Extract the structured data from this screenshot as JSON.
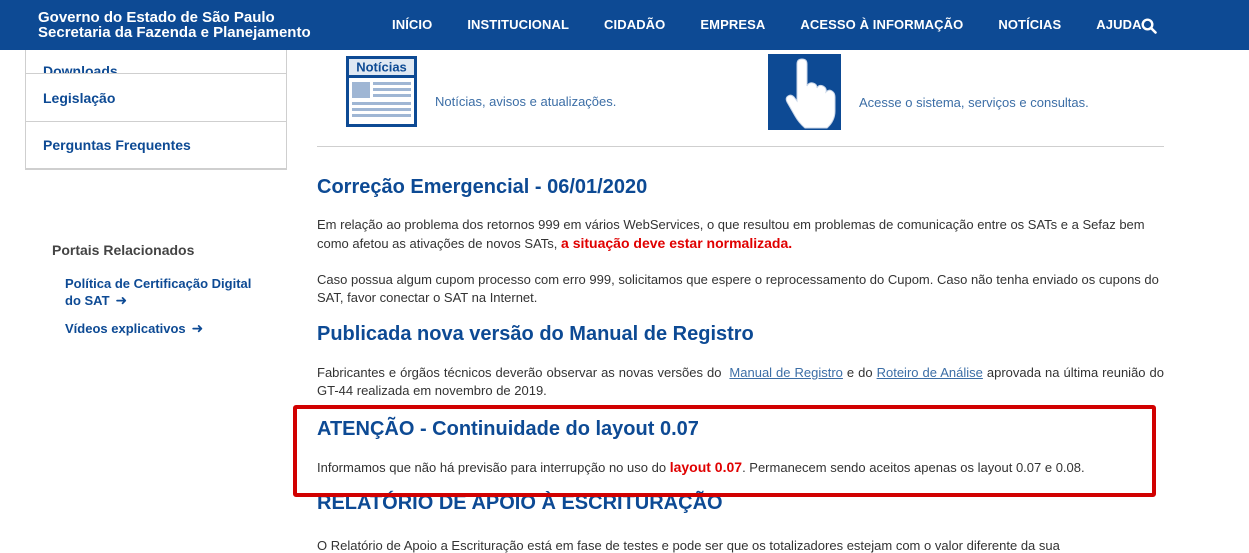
{
  "header": {
    "brand_line1": "Governo do Estado de São Paulo",
    "brand_line2": "Secretaria da Fazenda e Planejamento",
    "nav": [
      "INÍCIO",
      "INSTITUCIONAL",
      "CIDADÃO",
      "EMPRESA",
      "ACESSO À INFORMAÇÃO",
      "NOTÍCIAS",
      "AJUDA"
    ],
    "search_icon": "search-icon",
    "colors": {
      "bar": "#0d4a94"
    }
  },
  "sidebar": {
    "items": [
      "Downloads",
      "Legislação",
      "Perguntas Frequentes"
    ],
    "portais_title": "Portais Relacionados",
    "portais": [
      {
        "line1": "Política de Certificação Digital",
        "line2": "do SAT"
      },
      {
        "line1": "Vídeos explicativos"
      }
    ]
  },
  "boxes": {
    "news_label": "Notícias",
    "news_text": "Notícias, avisos e atualizações.",
    "access_text": "Acesse o sistema, serviços e consultas."
  },
  "articles": {
    "a1_title": "Correção Emergencial - 06/01/2020",
    "a1_p1_pre": "Em relação ao problema dos retornos 999 em vários WebServices, o que resultou em problemas de comunicação entre os SATs e a Sefaz bem como afetou as ativações de novos SATs,",
    "a1_p1_red": "a situação deve estar normalizada.",
    "a1_p2": "Caso possua algum cupom processo com erro 999, solicitamos que espere o reprocessamento do Cupom. Caso não tenha enviado os cupons do SAT, favor conectar o SAT na Internet.",
    "a2_title": "Publicada nova versão do Manual de Registro",
    "a2_pre": "Fabricantes e órgãos técnicos deverão observar as novas versões do",
    "a2_link1": "Manual de Registro",
    "a2_mid": "e do",
    "a2_link2": "Roteiro de Análise",
    "a2_post": "aprovada na última reunião do GT-44 realizada em novembro de 2019.",
    "a3_title": "ATENÇÃO - Continuidade do layout 0.07",
    "a3_pre": "Informamos que não há previsão para interrupção no uso do",
    "a3_red": "layout 0.07",
    "a3_post": ". Permanecem sendo aceitos apenas os layout 0.07 e 0.08.",
    "a4_title": "RELATÓRIO DE APOIO À ESCRITURAÇÃO",
    "a4_p": "O Relatório de Apoio a Escrituração está em fase de testes e pode ser que os totalizadores estejam com o valor diferente da sua"
  },
  "colors": {
    "accent": "#0d4a94",
    "highlight": "#d10000",
    "red_text": "#e00000"
  }
}
